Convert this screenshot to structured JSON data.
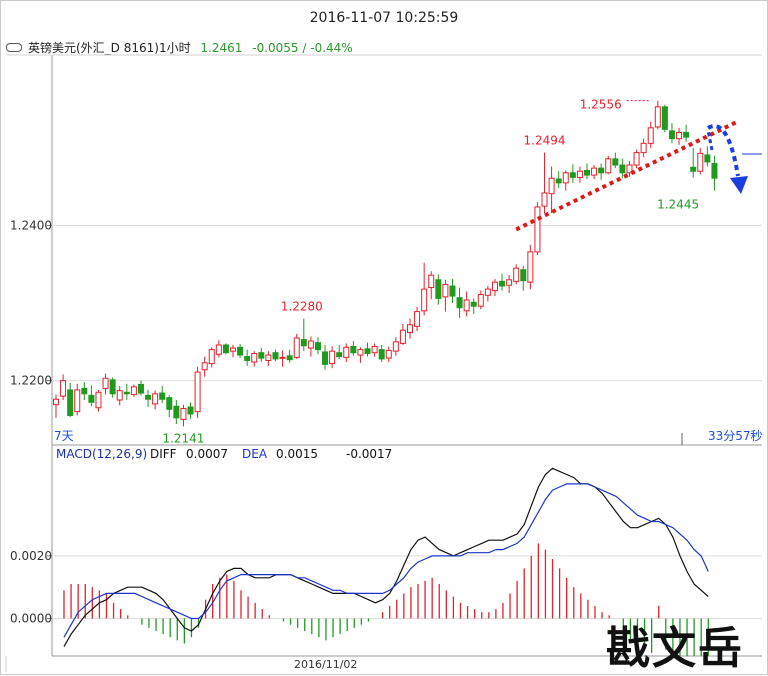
{
  "header": {
    "datetime": "2016-11-07 10:25:59",
    "instrument": "英镑美元(外汇_D 8161)1小时",
    "last_price": "1.2461",
    "change": "-0.0055 / -0.44%"
  },
  "watermark": "戡文岳",
  "colors": {
    "up": "#e8202a",
    "down": "#1f9a1f",
    "trend": "#dd1a1a",
    "arrow": "#1a3fe0",
    "diff_line": "#111111",
    "dea_line": "#1c36c8"
  },
  "chart_data": [
    {
      "type": "candlestick",
      "title": "英镑美元(外汇_D 8161)1小时",
      "yticks": [
        "1.2400",
        "1.2200"
      ],
      "ylim": [
        1.2117,
        1.2616
      ],
      "x_left_label": "7天",
      "x_right_label": "33分57秒",
      "annotations": [
        "1.2556",
        "1.2494",
        "1.2280",
        "1.2141",
        "1.2445"
      ],
      "series": [
        {
          "ohlc": [
            [
              1.2169,
              1.2182,
              1.2152,
              1.2176
            ],
            [
              1.218,
              1.2208,
              1.2175,
              1.22
            ],
            [
              1.2188,
              1.2197,
              1.2153,
              1.2155
            ],
            [
              1.216,
              1.2196,
              1.2155,
              1.2188
            ],
            [
              1.219,
              1.2198,
              1.2175,
              1.2183
            ],
            [
              1.2181,
              1.2194,
              1.2167,
              1.2172
            ],
            [
              1.2165,
              1.2188,
              1.216,
              1.2185
            ],
            [
              1.219,
              1.2209,
              1.2182,
              1.2203
            ],
            [
              1.2201,
              1.2204,
              1.2178,
              1.2183
            ],
            [
              1.2175,
              1.2193,
              1.2168,
              1.2187
            ],
            [
              1.2185,
              1.2196,
              1.2175,
              1.2183
            ],
            [
              1.2182,
              1.2195,
              1.2179,
              1.2192
            ],
            [
              1.2195,
              1.22,
              1.2181,
              1.2184
            ],
            [
              1.2181,
              1.2188,
              1.2166,
              1.2176
            ],
            [
              1.217,
              1.2187,
              1.2163,
              1.2183
            ],
            [
              1.2184,
              1.2193,
              1.2171,
              1.2176
            ],
            [
              1.2178,
              1.2181,
              1.2153,
              1.2163
            ],
            [
              1.2167,
              1.2175,
              1.2144,
              1.2152
            ],
            [
              1.215,
              1.2169,
              1.2141,
              1.2164
            ],
            [
              1.2166,
              1.2172,
              1.2151,
              1.2157
            ],
            [
              1.216,
              1.2218,
              1.2152,
              1.2211
            ],
            [
              1.2214,
              1.2231,
              1.2205,
              1.2223
            ],
            [
              1.2222,
              1.2243,
              1.2217,
              1.224
            ],
            [
              1.2234,
              1.2252,
              1.223,
              1.2246
            ],
            [
              1.2246,
              1.2248,
              1.2234,
              1.2236
            ],
            [
              1.2238,
              1.2246,
              1.223,
              1.2242
            ],
            [
              1.2243,
              1.2247,
              1.2229,
              1.2233
            ],
            [
              1.2231,
              1.224,
              1.2219,
              1.2226
            ],
            [
              1.2224,
              1.2238,
              1.2218,
              1.2235
            ],
            [
              1.2236,
              1.2242,
              1.2224,
              1.2229
            ],
            [
              1.2226,
              1.2238,
              1.2219,
              1.2233
            ],
            [
              1.2236,
              1.224,
              1.2225,
              1.2228
            ],
            [
              1.2229,
              1.2239,
              1.2218,
              1.223
            ],
            [
              1.2232,
              1.224,
              1.2223,
              1.2227
            ],
            [
              1.223,
              1.226,
              1.2228,
              1.2255
            ],
            [
              1.2253,
              1.228,
              1.2238,
              1.2245
            ],
            [
              1.2242,
              1.2257,
              1.2231,
              1.2251
            ],
            [
              1.2249,
              1.2256,
              1.2234,
              1.224
            ],
            [
              1.2237,
              1.2246,
              1.2214,
              1.2221
            ],
            [
              1.2222,
              1.2244,
              1.2216,
              1.2238
            ],
            [
              1.2236,
              1.2246,
              1.2228,
              1.2231
            ],
            [
              1.223,
              1.2248,
              1.2224,
              1.2243
            ],
            [
              1.2244,
              1.2251,
              1.2232,
              1.2236
            ],
            [
              1.2233,
              1.2243,
              1.2223,
              1.224
            ],
            [
              1.2241,
              1.2249,
              1.2231,
              1.2235
            ],
            [
              1.2236,
              1.2248,
              1.2231,
              1.2244
            ],
            [
              1.224,
              1.2246,
              1.2224,
              1.2228
            ],
            [
              1.2229,
              1.2244,
              1.2224,
              1.2239
            ],
            [
              1.2238,
              1.2256,
              1.2232,
              1.225
            ],
            [
              1.2248,
              1.2273,
              1.2246,
              1.2265
            ],
            [
              1.2262,
              1.228,
              1.2254,
              1.2272
            ],
            [
              1.227,
              1.2295,
              1.2264,
              1.2289
            ],
            [
              1.229,
              1.2352,
              1.2284,
              1.2318
            ],
            [
              1.232,
              1.2341,
              1.2305,
              1.2336
            ],
            [
              1.233,
              1.2337,
              1.2298,
              1.2306
            ],
            [
              1.2308,
              1.233,
              1.2289,
              1.2324
            ],
            [
              1.2322,
              1.2331,
              1.23,
              1.2309
            ],
            [
              1.2307,
              1.232,
              1.2281,
              1.2294
            ],
            [
              1.229,
              1.2315,
              1.2283,
              1.2304
            ],
            [
              1.2301,
              1.2306,
              1.2286,
              1.2296
            ],
            [
              1.2296,
              1.2316,
              1.2292,
              1.2311
            ],
            [
              1.231,
              1.2322,
              1.2302,
              1.2318
            ],
            [
              1.2316,
              1.2331,
              1.2309,
              1.2327
            ],
            [
              1.2328,
              1.2338,
              1.2316,
              1.2322
            ],
            [
              1.2323,
              1.2336,
              1.2313,
              1.233
            ],
            [
              1.2328,
              1.235,
              1.2324,
              1.2345
            ],
            [
              1.2343,
              1.2348,
              1.2316,
              1.2329
            ],
            [
              1.2327,
              1.2375,
              1.2318,
              1.2366
            ],
            [
              1.2366,
              1.243,
              1.2362,
              1.2424
            ],
            [
              1.2425,
              1.2494,
              1.2416,
              1.2442
            ],
            [
              1.2441,
              1.2476,
              1.2416,
              1.2461
            ],
            [
              1.246,
              1.247,
              1.2448,
              1.2455
            ],
            [
              1.2455,
              1.2471,
              1.2445,
              1.2468
            ],
            [
              1.2468,
              1.2479,
              1.2455,
              1.2462
            ],
            [
              1.2462,
              1.2476,
              1.2455,
              1.247
            ],
            [
              1.2471,
              1.248,
              1.246,
              1.2465
            ],
            [
              1.2465,
              1.2478,
              1.246,
              1.2474
            ],
            [
              1.2474,
              1.248,
              1.2459,
              1.2468
            ],
            [
              1.2468,
              1.249,
              1.2466,
              1.2486
            ],
            [
              1.2486,
              1.2494,
              1.2474,
              1.2478
            ],
            [
              1.2478,
              1.2486,
              1.2461,
              1.2468
            ],
            [
              1.2468,
              1.2483,
              1.2463,
              1.2478
            ],
            [
              1.2478,
              1.2498,
              1.2474,
              1.2494
            ],
            [
              1.2494,
              1.2512,
              1.2488,
              1.2506
            ],
            [
              1.2506,
              1.2534,
              1.25,
              1.2526
            ],
            [
              1.2527,
              1.2561,
              1.2524,
              1.2553
            ],
            [
              1.2553,
              1.2556,
              1.252,
              1.2524
            ],
            [
              1.2522,
              1.2532,
              1.2506,
              1.2512
            ],
            [
              1.2512,
              1.2526,
              1.2504,
              1.252
            ],
            [
              1.252,
              1.253,
              1.2508,
              1.2514
            ],
            [
              1.2475,
              1.25,
              1.2462,
              1.247
            ],
            [
              1.247,
              1.25,
              1.2466,
              1.2493
            ],
            [
              1.2491,
              1.2502,
              1.2476,
              1.2482
            ],
            [
              1.248,
              1.249,
              1.2445,
              1.2461
            ]
          ]
        }
      ]
    },
    {
      "type": "line",
      "title": "MACD(12,26,9)",
      "legend": [
        {
          "name": "DIFF",
          "value": "0.0007"
        },
        {
          "name": "DEA",
          "value": "0.0015"
        },
        {
          "name": "",
          "value": "-0.0017"
        }
      ],
      "yticks": [
        "0.0020",
        "0.0000"
      ],
      "ylim": [
        -0.0012,
        0.005
      ],
      "x_label": "2016/11/02",
      "series": [
        {
          "name": "DIFF",
          "values": [
            -0.0009,
            -0.0005,
            -0.0002,
            0.0001,
            0.0003,
            0.0005,
            0.0006,
            0.0008,
            0.0009,
            0.001,
            0.001,
            0.001,
            0.0009,
            0.0008,
            0.0006,
            0.0003,
            0.0,
            -0.0003,
            -0.0004,
            -0.0002,
            0.0003,
            0.0008,
            0.0012,
            0.0015,
            0.0016,
            0.0016,
            0.0014,
            0.0013,
            0.0013,
            0.0013,
            0.0014,
            0.0014,
            0.0014,
            0.0013,
            0.0012,
            0.0011,
            0.001,
            0.0009,
            0.0008,
            0.0008,
            0.0008,
            0.0008,
            0.0007,
            0.0006,
            0.0005,
            0.0006,
            0.0008,
            0.0012,
            0.0017,
            0.0022,
            0.0025,
            0.0026,
            0.0024,
            0.0022,
            0.0021,
            0.002,
            0.0021,
            0.0022,
            0.0023,
            0.0024,
            0.0025,
            0.0025,
            0.0025,
            0.0026,
            0.0027,
            0.003,
            0.0036,
            0.0042,
            0.0046,
            0.0048,
            0.0047,
            0.0046,
            0.0045,
            0.0043,
            0.0043,
            0.0042,
            0.004,
            0.0037,
            0.0034,
            0.0031,
            0.0029,
            0.0029,
            0.003,
            0.0031,
            0.0032,
            0.003,
            0.0026,
            0.002,
            0.0015,
            0.0011,
            0.0009,
            0.0007
          ]
        },
        {
          "name": "DEA",
          "values": [
            -0.0006,
            -0.0002,
            0.0002,
            0.0004,
            0.0006,
            0.0007,
            0.0008,
            0.0008,
            0.0008,
            0.0008,
            0.0008,
            0.0007,
            0.0006,
            0.0005,
            0.0004,
            0.0003,
            0.0002,
            0.0001,
            0.0,
            0.0,
            0.0002,
            0.0005,
            0.0009,
            0.0012,
            0.0013,
            0.0014,
            0.0014,
            0.0014,
            0.0014,
            0.0014,
            0.0014,
            0.0014,
            0.0014,
            0.0013,
            0.0013,
            0.0012,
            0.0011,
            0.001,
            0.0009,
            0.0009,
            0.0008,
            0.0008,
            0.0008,
            0.0008,
            0.0008,
            0.0008,
            0.0009,
            0.0011,
            0.0013,
            0.0016,
            0.0018,
            0.0019,
            0.002,
            0.002,
            0.002,
            0.002,
            0.002,
            0.0021,
            0.0021,
            0.0021,
            0.0021,
            0.0022,
            0.0022,
            0.0023,
            0.0024,
            0.0026,
            0.003,
            0.0034,
            0.0038,
            0.0041,
            0.0042,
            0.0043,
            0.0043,
            0.0043,
            0.0043,
            0.0042,
            0.0041,
            0.004,
            0.0039,
            0.0037,
            0.0035,
            0.0033,
            0.0032,
            0.0031,
            0.0031,
            0.003,
            0.0029,
            0.0027,
            0.0025,
            0.0022,
            0.002,
            0.0015
          ]
        },
        {
          "name": "MACD",
          "values": [
            0.0009,
            0.0011,
            0.0011,
            0.0011,
            0.001,
            0.0009,
            0.0008,
            0.0005,
            0.0003,
            0.0001,
            0.0,
            -0.0002,
            -0.0003,
            -0.0004,
            -0.0005,
            -0.0006,
            -0.0007,
            -0.0008,
            -0.0006,
            -0.0003,
            0.0006,
            0.0011,
            0.0013,
            0.0014,
            0.0012,
            0.0009,
            0.0007,
            0.0005,
            0.0003,
            0.0001,
            0.0,
            -0.0001,
            -0.0002,
            -0.0003,
            -0.0004,
            -0.0005,
            -0.0006,
            -0.0007,
            -0.0006,
            -0.0005,
            -0.0004,
            -0.0003,
            -0.0002,
            -0.0001,
            0.0,
            0.0002,
            0.0004,
            0.0006,
            0.0008,
            0.001,
            0.0011,
            0.0012,
            0.0013,
            0.0011,
            0.0009,
            0.0007,
            0.0005,
            0.0004,
            0.0003,
            0.0002,
            0.0002,
            0.0003,
            0.0005,
            0.0008,
            0.0012,
            0.0016,
            0.002,
            0.0024,
            0.0022,
            0.0019,
            0.0016,
            0.0013,
            0.001,
            0.0008,
            0.0006,
            0.0004,
            0.0002,
            0.0001,
            0.0,
            -0.0006,
            -0.0008,
            -0.0009,
            -0.001,
            -0.0011,
            0.0004,
            -0.001,
            -0.0011,
            -0.0012,
            -0.0012,
            -0.0012,
            -0.0012,
            -0.0012
          ]
        }
      ]
    }
  ]
}
